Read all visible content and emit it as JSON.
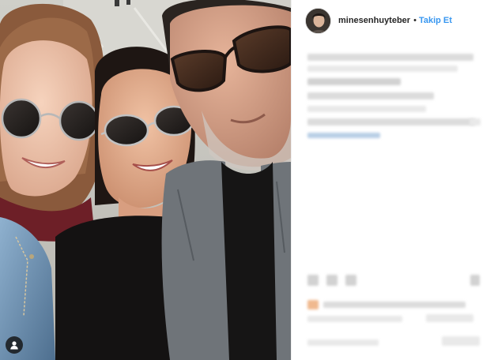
{
  "post": {
    "username": "minesenhuyteber",
    "separator": "•",
    "follow_label": "Takip Et"
  },
  "icons": {
    "user_tags": "user-silhouette-icon",
    "avatar": "profile-picture"
  },
  "colors": {
    "follow_blue": "#3897f0",
    "username": "#262626",
    "divider": "#efefef"
  }
}
